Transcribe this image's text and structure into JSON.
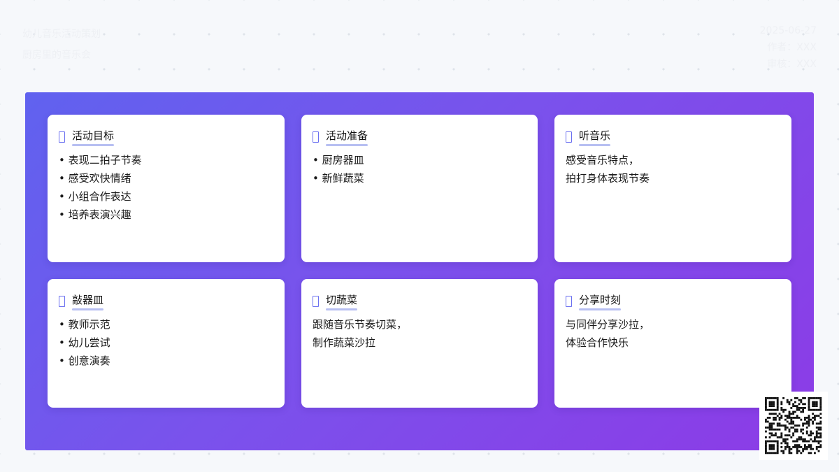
{
  "header": {
    "title": "幼儿音乐活动策划",
    "subtitle": "厨房里的音乐会",
    "date": "2025-06-27",
    "author": "作者：XXX",
    "reviewer": "审核：XXX"
  },
  "cards": [
    {
      "title": "活动目标",
      "items": [
        "表现二拍子节奏",
        "感受欢快情绪",
        "小组合作表达",
        "培养表演兴趣"
      ]
    },
    {
      "title": "活动准备",
      "items": [
        "厨房器皿",
        "新鲜蔬菜"
      ]
    },
    {
      "title": "听音乐",
      "lines": [
        "感受音乐特点，",
        "拍打身体表现节奏"
      ]
    },
    {
      "title": "敲器皿",
      "items": [
        "教师示范",
        "幼儿尝试",
        "创意演奏"
      ]
    },
    {
      "title": "切蔬菜",
      "lines": [
        "跟随音乐节奏切菜，",
        "制作蔬菜沙拉"
      ]
    },
    {
      "title": "分享时刻",
      "lines": [
        "与同伴分享沙拉，",
        "体验合作快乐"
      ]
    }
  ],
  "colors": {
    "panel_start": "#6062ef",
    "panel_end": "#8c3be6",
    "icon": "#6a6ff0",
    "underline": "#b7bff2"
  },
  "icons": {
    "card_title_icon": "square-outline-icon",
    "qr_code": "qr-code"
  }
}
